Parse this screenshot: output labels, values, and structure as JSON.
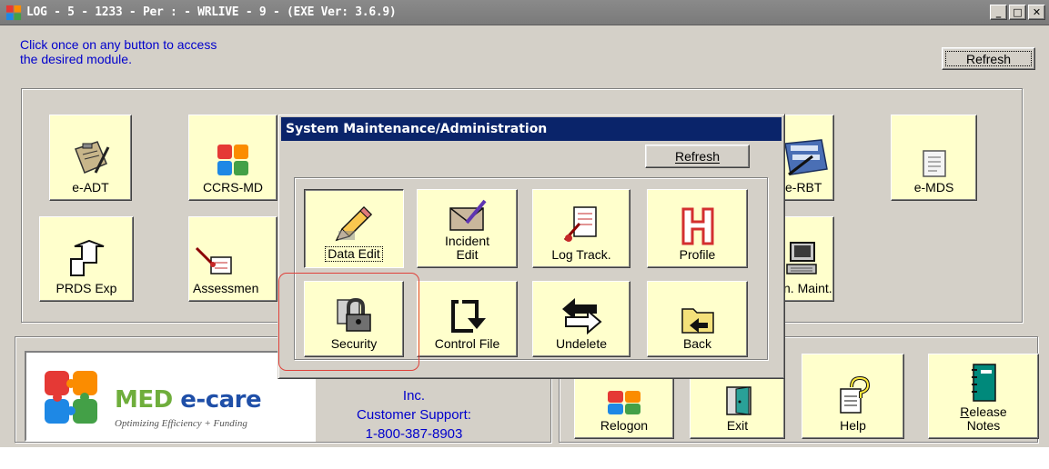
{
  "window": {
    "title": "LOG - 5 - 1233 - Per :  - WRLIVE - 9 - (EXE Ver: 3.6.9)",
    "controls": [
      "_",
      "□",
      "✕"
    ]
  },
  "instructions": {
    "line1": "Click once on any button to access",
    "line2": "the desired module."
  },
  "main_refresh_label": "Refresh",
  "modules_row1": [
    {
      "label": "e-ADT",
      "icon": "clipboard-pen-icon"
    },
    {
      "label": "CCRS-MD",
      "icon": "puzzle-logo-icon"
    },
    {
      "label": "e-RBT",
      "icon": "keyboard-icon"
    },
    {
      "label": "e-MDS",
      "icon": "document-icon"
    }
  ],
  "modules_row2": [
    {
      "label": "PRDS Exp",
      "icon": "export-arrow-icon"
    },
    {
      "label": "Assessmen",
      "icon": "assessment-icon"
    },
    {
      "label": "n. Maint.",
      "icon": "computer-icon"
    }
  ],
  "support": {
    "line1": "Inc.",
    "line2": "Customer Support:",
    "line3": "1-800-387-8903"
  },
  "logo": {
    "brand_part1": "MED",
    "brand_part2": "e-care",
    "tagline": "Optimizing Efficiency + Funding"
  },
  "bottom_buttons": [
    {
      "label": "Relogon",
      "icon": "puzzle-logo-icon"
    },
    {
      "label": "Exit",
      "icon": "exit-door-icon"
    },
    {
      "label": "Help",
      "icon": "help-icon"
    },
    {
      "label_line1": "Release",
      "label_line2": "Notes",
      "icon": "notebook-icon"
    }
  ],
  "dialog": {
    "title": "System Maintenance/Administration",
    "refresh_label": "Refresh",
    "buttons_row1": [
      {
        "label": "Data Edit",
        "icon": "pencil-eraser-icon"
      },
      {
        "label_line1": "Incident",
        "label_line2": "Edit",
        "icon": "envelope-pen-icon"
      },
      {
        "label": "Log Track.",
        "icon": "log-track-icon"
      },
      {
        "label": "Profile",
        "icon": "h-icon"
      }
    ],
    "buttons_row2": [
      {
        "label": "Security",
        "icon": "padlock-icon"
      },
      {
        "label": "Control File",
        "icon": "control-arrow-icon"
      },
      {
        "label": "Undelete",
        "icon": "swap-arrows-icon"
      },
      {
        "label": "Back",
        "icon": "folder-back-icon"
      }
    ]
  },
  "colors": {
    "window_bg": "#d4d0c8",
    "module_button_bg": "#ffffcc",
    "dialog_title_bg": "#0a246a",
    "instruction_text": "#0000cc",
    "highlight_ring": "#e0413a"
  }
}
